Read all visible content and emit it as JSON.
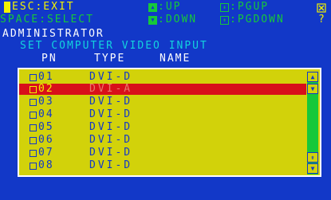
{
  "header": {
    "line1_esc": "ESC:EXIT",
    "line1_up": ":UP",
    "line1_pgup": ":PGUP",
    "line2_space": "SPACE:SELECT",
    "line2_down": ":DOWN",
    "line2_pgdown": ":PGDOWN",
    "user": "ADMINISTRATOR",
    "title": "SET COMPUTER VIDEO INPUT"
  },
  "columns": {
    "pn": "PN",
    "type": "TYPE",
    "name": "NAME"
  },
  "rows": [
    {
      "pn": "01",
      "type": "DVI-D",
      "selected": false
    },
    {
      "pn": "02",
      "type": "DVI-A",
      "selected": true
    },
    {
      "pn": "03",
      "type": "DVI-D",
      "selected": false
    },
    {
      "pn": "04",
      "type": "DVI-D",
      "selected": false
    },
    {
      "pn": "05",
      "type": "DVI-D",
      "selected": false
    },
    {
      "pn": "06",
      "type": "DVI-D",
      "selected": false
    },
    {
      "pn": "07",
      "type": "DVI-D",
      "selected": false
    },
    {
      "pn": "08",
      "type": "DVI-D",
      "selected": false
    }
  ],
  "icons": {
    "up_key": "up-arrow-key-icon",
    "down_key": "down-arrow-key-icon",
    "pgup_key": "page-up-key-icon",
    "pgdown_key": "page-down-key-icon",
    "port": "port-icon",
    "exit": "exit-icon"
  },
  "colors": {
    "background": "#1238c8",
    "header_yellow": "#f2f200",
    "header_green": "#16c83a",
    "title_cyan": "#12d2de",
    "panel_yellow": "#d2d20a",
    "selected_red": "#d80f1a"
  }
}
